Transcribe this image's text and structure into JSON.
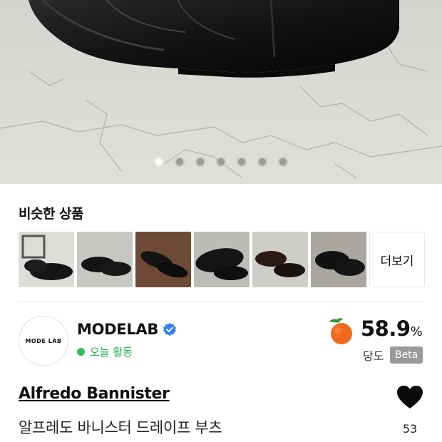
{
  "gallery": {
    "total_images": 7,
    "current_index": 0
  },
  "similar": {
    "title": "비슷한 상품",
    "more_label": "더보기"
  },
  "seller": {
    "logo_text": "MODE LAB",
    "name": "MODELAB",
    "status": "오늘 활동",
    "score": "58.9",
    "score_unit": "%",
    "score_label": "당도",
    "beta_label": "Beta"
  },
  "product": {
    "brand": "Alfredo Bannister",
    "name": "알프레도 바니스터 드레이프 부츠",
    "likes": "53"
  },
  "colors": {
    "status_green": "#2fc05a",
    "verified_blue": "#2f7ff5",
    "peach_orange": "#f26b1d",
    "beta_gray": "#9a9a9a"
  }
}
